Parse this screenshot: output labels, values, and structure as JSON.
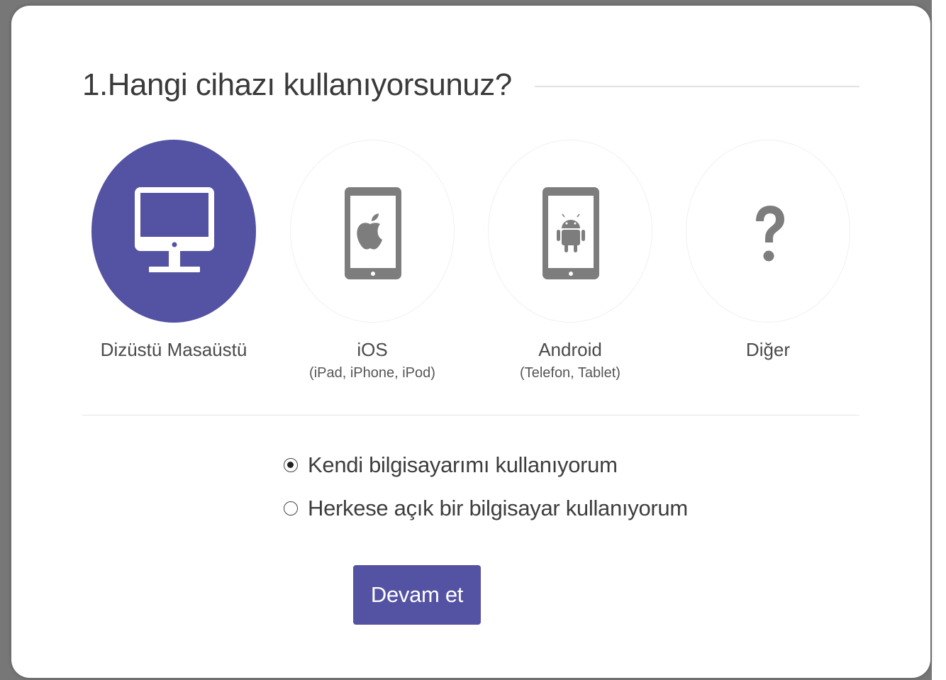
{
  "dialog": {
    "title": "1.Hangi cihazı kullanıyorsunuz?",
    "devices": [
      {
        "icon": "desktop-monitor-icon",
        "label": "Dizüstü Masaüstü",
        "sublabel": "",
        "selected": true
      },
      {
        "icon": "apple-tablet-icon",
        "label": "iOS",
        "sublabel": "(iPad, iPhone, iPod)",
        "selected": false
      },
      {
        "icon": "android-tablet-icon",
        "label": "Android",
        "sublabel": "(Telefon, Tablet)",
        "selected": false
      },
      {
        "icon": "question-mark-icon",
        "label": "Diğer",
        "sublabel": "",
        "selected": false
      }
    ],
    "options": [
      {
        "label": "Kendi bilgisayarımı kullanıyorum",
        "checked": true
      },
      {
        "label": "Herkese açık bir bilgisayar kullanıyorum",
        "checked": false
      }
    ],
    "continue_label": "Devam et"
  },
  "colors": {
    "accent": "#5452a3",
    "icon_gray": "#7d7d7d"
  }
}
